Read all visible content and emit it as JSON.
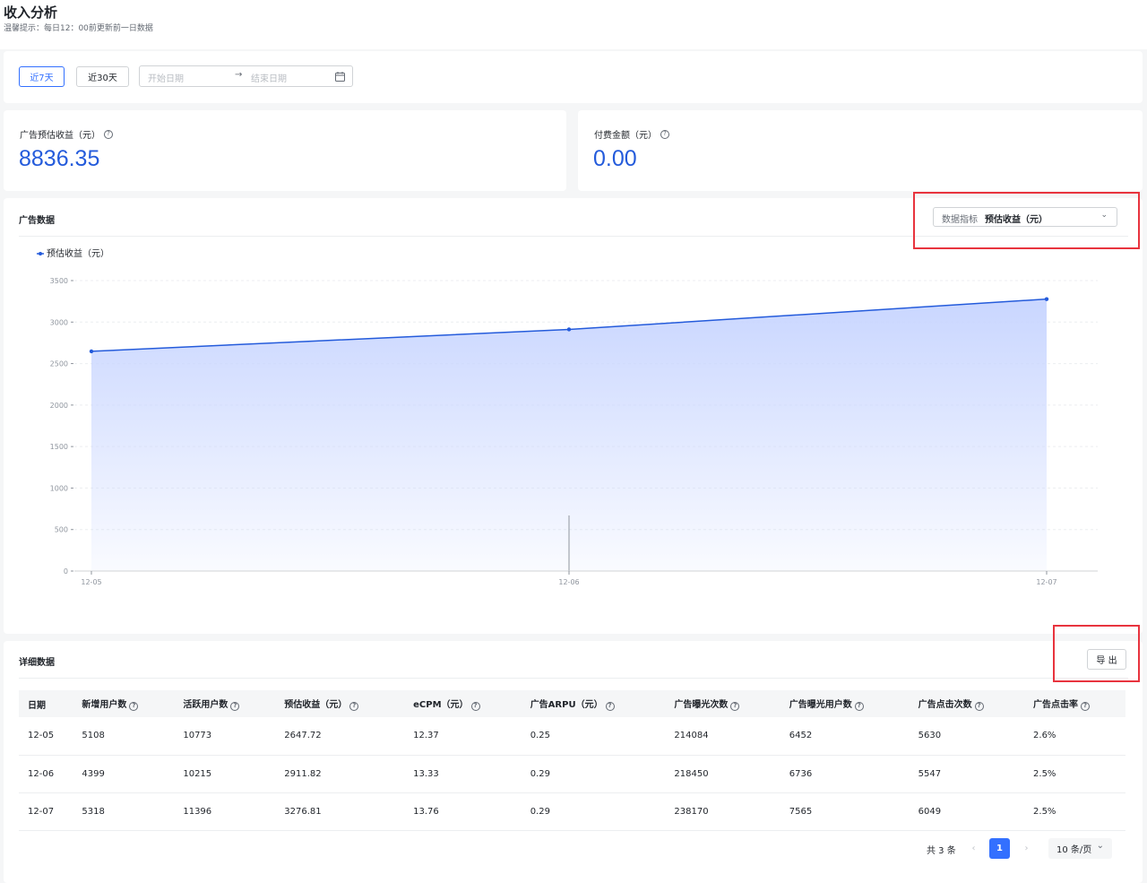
{
  "header": {
    "title": "收入分析",
    "tip": "温馨提示：每日12：00前更新前一日数据"
  },
  "filter": {
    "btn_7d": "近7天",
    "btn_30d": "近30天",
    "start_placeholder": "开始日期",
    "arrow": "→",
    "end_placeholder": "结束日期"
  },
  "metrics": [
    {
      "label": "广告预估收益（元）",
      "value": "8836.35"
    },
    {
      "label": "付费金额（元）",
      "value": "0.00"
    }
  ],
  "ad_section": {
    "title": "广告数据",
    "select_label": "数据指标",
    "select_value": "预估收益（元）"
  },
  "chart_data": {
    "type": "area",
    "legend": "预估收益（元）",
    "x": [
      "12-05",
      "12-06",
      "12-07"
    ],
    "series": [
      {
        "name": "预估收益（元）",
        "values": [
          2647.72,
          2911.82,
          3276.81
        ]
      }
    ],
    "ylim": [
      0,
      3500
    ],
    "yticks": [
      "0",
      "500",
      "1000",
      "1500",
      "2000",
      "2500",
      "3000",
      "3500"
    ],
    "yticks_values": [
      0,
      500,
      1000,
      1500,
      2000,
      2500,
      3000,
      3500
    ],
    "line_color": "#245bdb",
    "fill_color": "#c9d6ff",
    "grid": true,
    "legend_position": "top-left"
  },
  "detail": {
    "title": "详细数据",
    "export": "导 出",
    "columns": [
      "日期",
      "新增用户数",
      "活跃用户数",
      "预估收益（元）",
      "eCPM（元）",
      "广告ARPU（元）",
      "广告曝光次数",
      "广告曝光用户数",
      "广告点击次数",
      "广告点击率"
    ],
    "column_help": [
      false,
      true,
      true,
      true,
      true,
      true,
      true,
      true,
      true,
      true
    ],
    "rows": [
      [
        "12-05",
        "5108",
        "10773",
        "2647.72",
        "12.37",
        "0.25",
        "214084",
        "6452",
        "5630",
        "2.6%"
      ],
      [
        "12-06",
        "4399",
        "10215",
        "2911.82",
        "13.33",
        "0.29",
        "218450",
        "6736",
        "5547",
        "2.5%"
      ],
      [
        "12-07",
        "5318",
        "11396",
        "3276.81",
        "13.76",
        "0.29",
        "238170",
        "7565",
        "6049",
        "2.5%"
      ]
    ],
    "pagination": {
      "total": "共 3 条",
      "prev": "‹",
      "current": "1",
      "next": "›",
      "size": "10 条/页",
      "size_chev": "⌄"
    }
  },
  "colors": {
    "accent": "#3370ff",
    "value_blue": "#245bdb",
    "highlight_red": "#e8343e"
  }
}
